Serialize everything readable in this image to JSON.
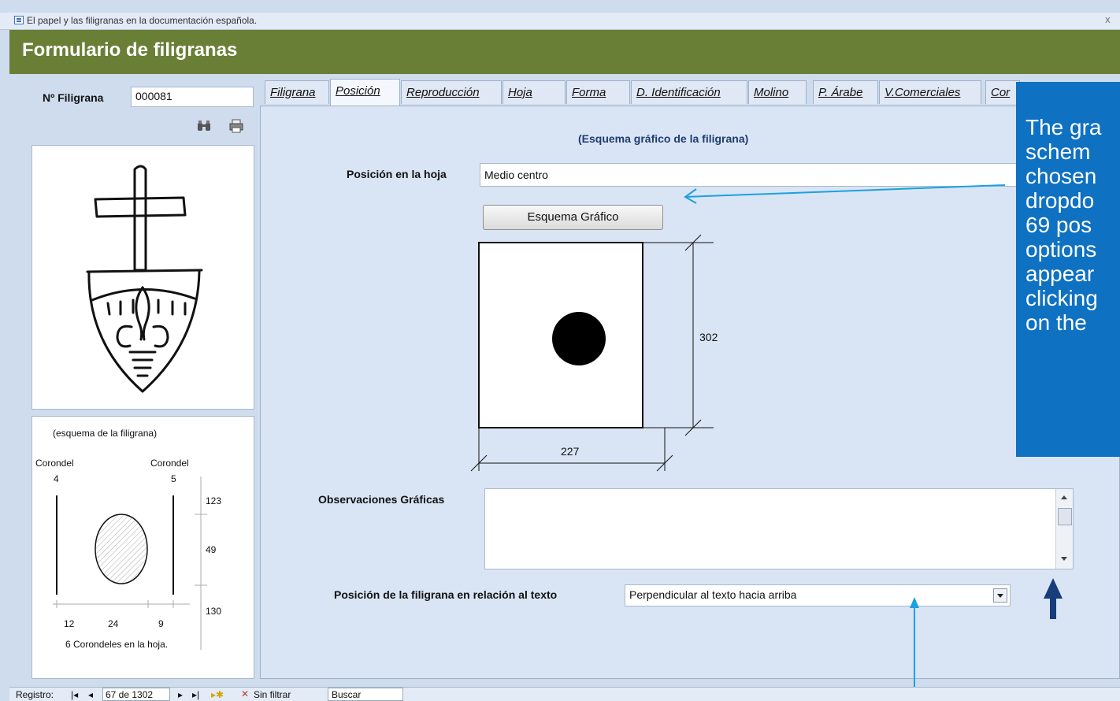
{
  "window": {
    "title": "El papel y las filigranas en la documentación española.",
    "close": "x"
  },
  "header": {
    "title": "Formulario de filigranas"
  },
  "left": {
    "id_label": "Nº Filigrana",
    "id_value": "000081",
    "scheme_caption": "(esquema de la filigrana)",
    "corondel_left": "Corondel",
    "corondel_right": "Corondel",
    "corondel_left_num": "4",
    "corondel_right_num": "5",
    "right_dims": [
      "123",
      "49",
      "130"
    ],
    "bottom_dims": [
      "12",
      "24",
      "9"
    ],
    "count_text": "6 Corondeles en la hoja."
  },
  "tabs": [
    {
      "label": "Filigrana"
    },
    {
      "label": "Posición"
    },
    {
      "label": "Reproducción"
    },
    {
      "label": "Hoja"
    },
    {
      "label": "Forma"
    },
    {
      "label": "D. Identificación"
    },
    {
      "label": "Molino"
    },
    {
      "label": "P. Árabe"
    },
    {
      "label": "V.Comerciales"
    },
    {
      "label": "Cor"
    }
  ],
  "position_tab": {
    "heading": "(Esquema gráfico de la filigrana)",
    "pos_label": "Posición en la hoja",
    "pos_value": "Medio centro",
    "scheme_button": "Esquema Gráfico",
    "height_dim": "302",
    "width_dim": "227",
    "obs_label": "Observaciones Gráficas",
    "obs_value": "",
    "text_pos_label": "Posición de la filigrana en relación al texto",
    "text_pos_value": "Perpendicular al texto hacia arriba"
  },
  "callout": {
    "text": "The gra\nschem\nchosen\ndropdo\n69 pos\noptions\nappear\nclicking\non the"
  },
  "status": {
    "record_label": "Registro:",
    "record_value": "67 de 1302",
    "filter": "Sin filtrar",
    "search": "Buscar"
  },
  "colors": {
    "header": "#6a7f36",
    "callout": "#0e71c2",
    "arrow_dark": "#173d7a",
    "arrow_light": "#1da0e0"
  }
}
